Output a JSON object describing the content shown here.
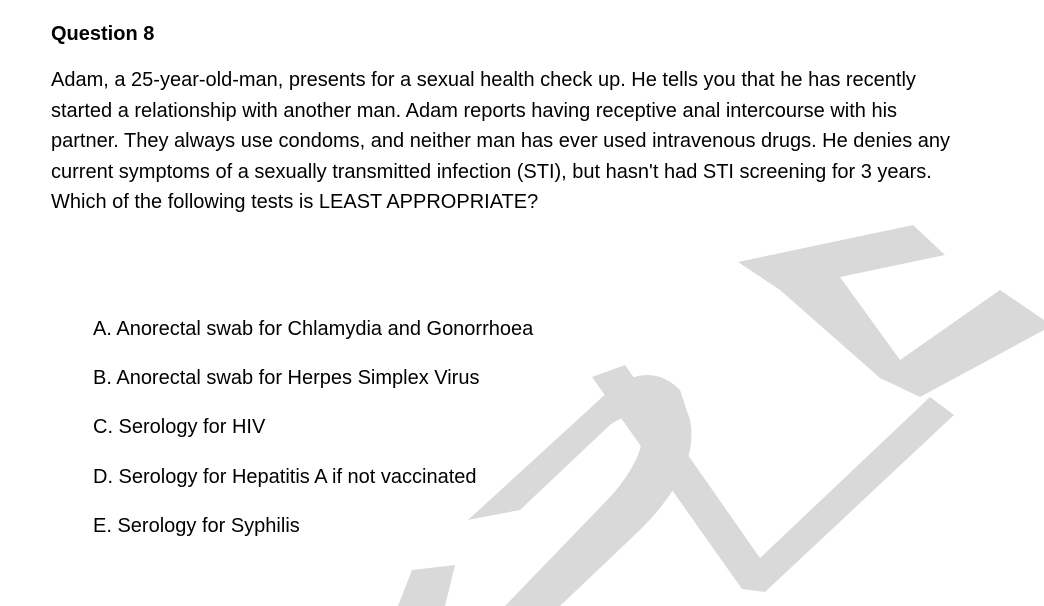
{
  "question": {
    "title": "Question 8",
    "stem": "Adam, a 25-year-old-man, presents for a sexual health check up. He tells you that he has recently started a relationship with another man. Adam reports having receptive anal intercourse with his partner. They always use condoms, and neither man has ever used intravenous drugs. He denies any current symptoms of a sexually transmitted infection (STI), but hasn't had STI screening for 3 years. Which of the following tests is LEAST APPROPRIATE?",
    "options": [
      "A. Anorectal swab for Chlamydia and Gonorrhoea",
      "B. Anorectal swab for Herpes Simplex Virus",
      "C. Serology for HIV",
      "D. Serology for Hepatitis A if not vaccinated",
      "E. Serology for Syphilis"
    ]
  },
  "watermark": {
    "color": "#d9d9d9"
  }
}
